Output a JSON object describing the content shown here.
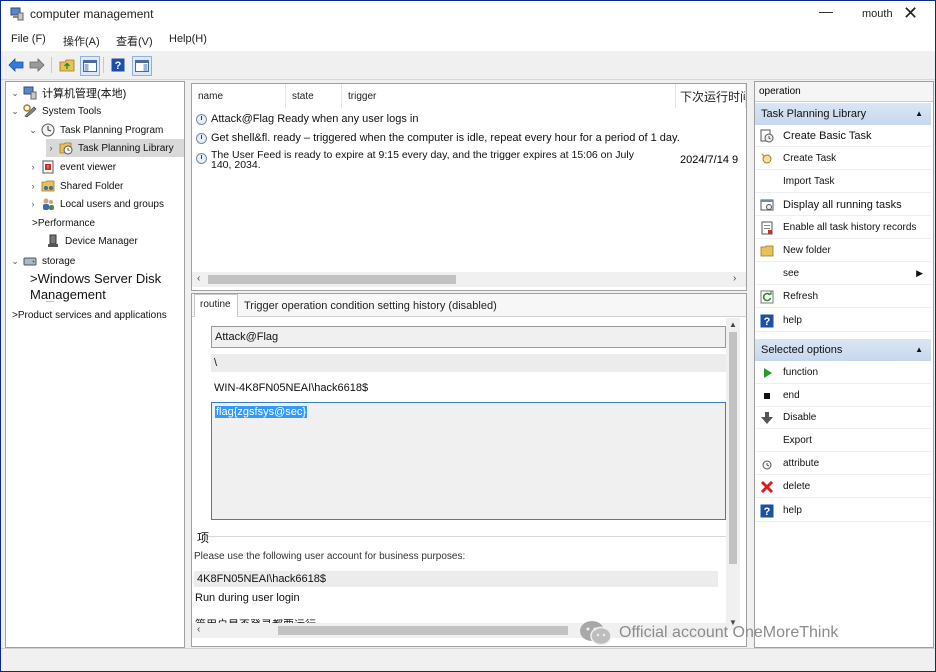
{
  "window": {
    "title": "computer management",
    "user": "mouth",
    "minimize_glyph": "—",
    "close_glyph": "✕"
  },
  "menu": [
    "File (F)",
    "操作(A)",
    "查看(V)",
    "Help(H)"
  ],
  "toolbar_icons": [
    "back-arrow-icon",
    "forward-arrow-icon",
    "up-folder-icon",
    "show-hide-tree-icon",
    "help-icon",
    "show-hide-action-icon"
  ],
  "tree": {
    "root": "计算机管理(本地)",
    "system_tools": "System Tools",
    "task_scheduler": "Task Planning Program",
    "task_library": "Task Planning Library",
    "event_viewer": "event viewer",
    "shared_folder": "Shared Folder",
    "local_users": "Local users and groups",
    "performance": ">Performance",
    "device_manager": "Device Manager",
    "storage": "storage",
    "disk_mgmt_1": ">Windows Server Disk",
    "disk_mgmt_2": "Management",
    "services": ">Product services and applications",
    "separator_mark": "—"
  },
  "task_list": {
    "columns": [
      "name",
      "state",
      "trigger",
      "下次运行时间"
    ],
    "rows": [
      {
        "text": "Attack@Flag Ready when any user logs in",
        "next": ""
      },
      {
        "text": "Get shell&fl. ready – triggered when the computer is idle, repeat every hour for a period of 1 day.",
        "next": ""
      },
      {
        "text": "The User Feed is ready to expire at 9:15 every day, and the trigger expires at 15:06 on July",
        "text2": "140, 2034.",
        "next": "2024/7/14 9"
      }
    ]
  },
  "details": {
    "tabs": [
      "routine",
      "Trigger operation condition setting history (disabled)"
    ],
    "name_value": "Attack@Flag",
    "location_value": "\\",
    "author_value": "WIN-4K8FN05NEAI\\hack6618$",
    "description_value": "flag{zgsfsys@sec}",
    "options_label": "项",
    "account_prompt": "Please use the following user account for business purposes:",
    "account_value": "4K8FN05NEAI\\hack6618$",
    "run_label": "Run during user login",
    "cut_label": "篇用户是否登录都要运行"
  },
  "actions": {
    "pane_title": "operation",
    "section1_title": "Task Planning Library",
    "section1_items": [
      {
        "label": "Create Basic Task",
        "icon": "create-basic-task-icon"
      },
      {
        "label": "Create Task",
        "icon": "create-task-icon"
      },
      {
        "label": "Import Task",
        "icon": ""
      },
      {
        "label": "Display all running tasks",
        "icon": "running-tasks-icon"
      },
      {
        "label": "Enable all task history records",
        "icon": "history-icon"
      },
      {
        "label": "New folder",
        "icon": "folder-icon"
      },
      {
        "label": "see",
        "icon": ""
      },
      {
        "label": "Refresh",
        "icon": "refresh-icon"
      },
      {
        "label": "help",
        "icon": "help-icon"
      }
    ],
    "section2_title": "Selected options",
    "section2_items": [
      {
        "label": "function",
        "icon": "run-icon"
      },
      {
        "label": "end",
        "icon": "stop-icon"
      },
      {
        "label": "Disable",
        "icon": "disable-icon"
      },
      {
        "label": "Export",
        "icon": ""
      },
      {
        "label": "attribute",
        "icon": "properties-icon"
      },
      {
        "label": "delete",
        "icon": "delete-icon"
      },
      {
        "label": "help",
        "icon": "help-icon"
      }
    ]
  },
  "watermark": "Official account OneMoreThink",
  "colors": {
    "desktop": "#0a2a8a",
    "action_header": "#c6d7ee",
    "selection": "#3399ff",
    "run_green": "#2a9a2a",
    "delete_red": "#d81e1e",
    "help_blue": "#1b4fa8"
  }
}
